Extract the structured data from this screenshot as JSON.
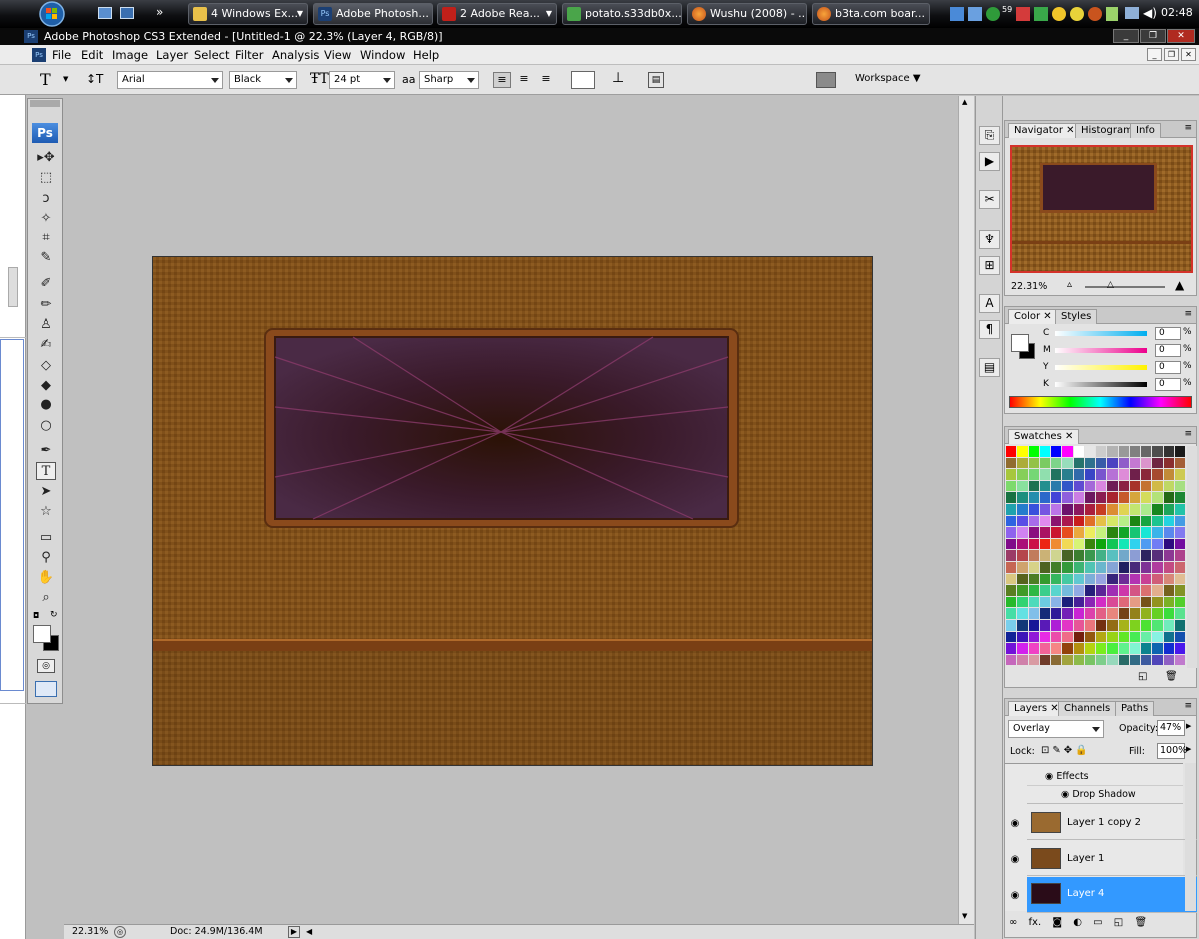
{
  "taskbar": {
    "buttons": [
      {
        "label": "4 Windows Ex...",
        "icon": "folder-icon"
      },
      {
        "label": "Adobe Photosh...",
        "icon": "photoshop-icon"
      },
      {
        "label": "2 Adobe Rea...",
        "icon": "acrobat-icon"
      },
      {
        "label": "potato.s33db0x...",
        "icon": "browser-icon"
      },
      {
        "label": "Wushu (2008) - ...",
        "icon": "firefox-icon"
      },
      {
        "label": "b3ta.com boar...",
        "icon": "firefox-icon"
      }
    ],
    "overflow": "»",
    "tray_badge": "59",
    "clock": "02:48"
  },
  "window": {
    "title": "Adobe Photoshop CS3 Extended - [Untitled-1 @ 22.3% (Layer 4, RGB/8)]",
    "app_badge": "Ps"
  },
  "menu": [
    "File",
    "Edit",
    "Image",
    "Layer",
    "Select",
    "Filter",
    "Analysis",
    "View",
    "Window",
    "Help"
  ],
  "options": {
    "tool_glyph": "T",
    "font_family": "Arial",
    "font_style": "Black",
    "font_size": "24 pt",
    "aa_label": "aa",
    "antialias": "Sharp",
    "workspace": "Workspace"
  },
  "toolbox": {
    "badge": "Ps"
  },
  "status": {
    "zoom": "22.31%",
    "doc": "Doc: 24.9M/136.4M"
  },
  "navigator": {
    "tabs": [
      "Navigator",
      "Histogram",
      "Info"
    ],
    "zoom": "22.31%"
  },
  "color": {
    "tabs": [
      "Color",
      "Styles"
    ],
    "channels": [
      {
        "label": "C",
        "value": "0",
        "unit": "%"
      },
      {
        "label": "M",
        "value": "0",
        "unit": "%"
      },
      {
        "label": "Y",
        "value": "0",
        "unit": "%"
      },
      {
        "label": "K",
        "value": "0",
        "unit": "%"
      }
    ]
  },
  "swatches": {
    "tabs": [
      "Swatches"
    ]
  },
  "layers": {
    "tabs": [
      "Layers",
      "Channels",
      "Paths"
    ],
    "blend_mode": "Overlay",
    "opacity_label": "Opacity:",
    "opacity": "47%",
    "lock_label": "Lock:",
    "fill_label": "Fill:",
    "fill": "100%",
    "effects_label": "Effects",
    "effect_item": "Drop Shadow",
    "items": [
      {
        "name": "Layer 1 copy 2",
        "selected": false
      },
      {
        "name": "Layer 1",
        "selected": false
      },
      {
        "name": "Layer 4",
        "selected": true
      }
    ]
  },
  "colors": {
    "accent": "#3399ff",
    "selected_layer": "#3399ff"
  }
}
